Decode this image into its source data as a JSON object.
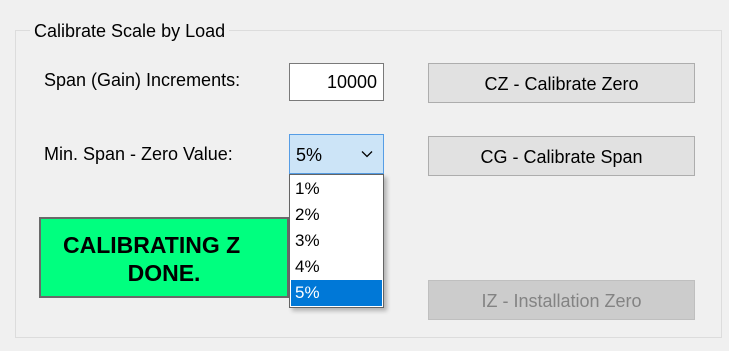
{
  "group": {
    "title": "Calibrate Scale by Load"
  },
  "span_increments": {
    "label": "Span (Gain) Increments:",
    "value": "10000"
  },
  "min_span": {
    "label": "Min. Span - Zero Value:",
    "selected": "5%",
    "options": [
      "1%",
      "2%",
      "3%",
      "4%",
      "5%"
    ]
  },
  "buttons": {
    "calibrate_zero": "CZ - Calibrate Zero",
    "calibrate_span": "CG - Calibrate Span",
    "installation_zero": "IZ - Installation Zero"
  },
  "status": {
    "line1": "CALIBRATING Z",
    "line2": "DONE.",
    "background": "#00ff7f"
  },
  "colors": {
    "selection": "#0078d7",
    "combo_focus": "#cce4f7"
  },
  "icons": {
    "combo_arrow": "chevron-down-icon"
  }
}
